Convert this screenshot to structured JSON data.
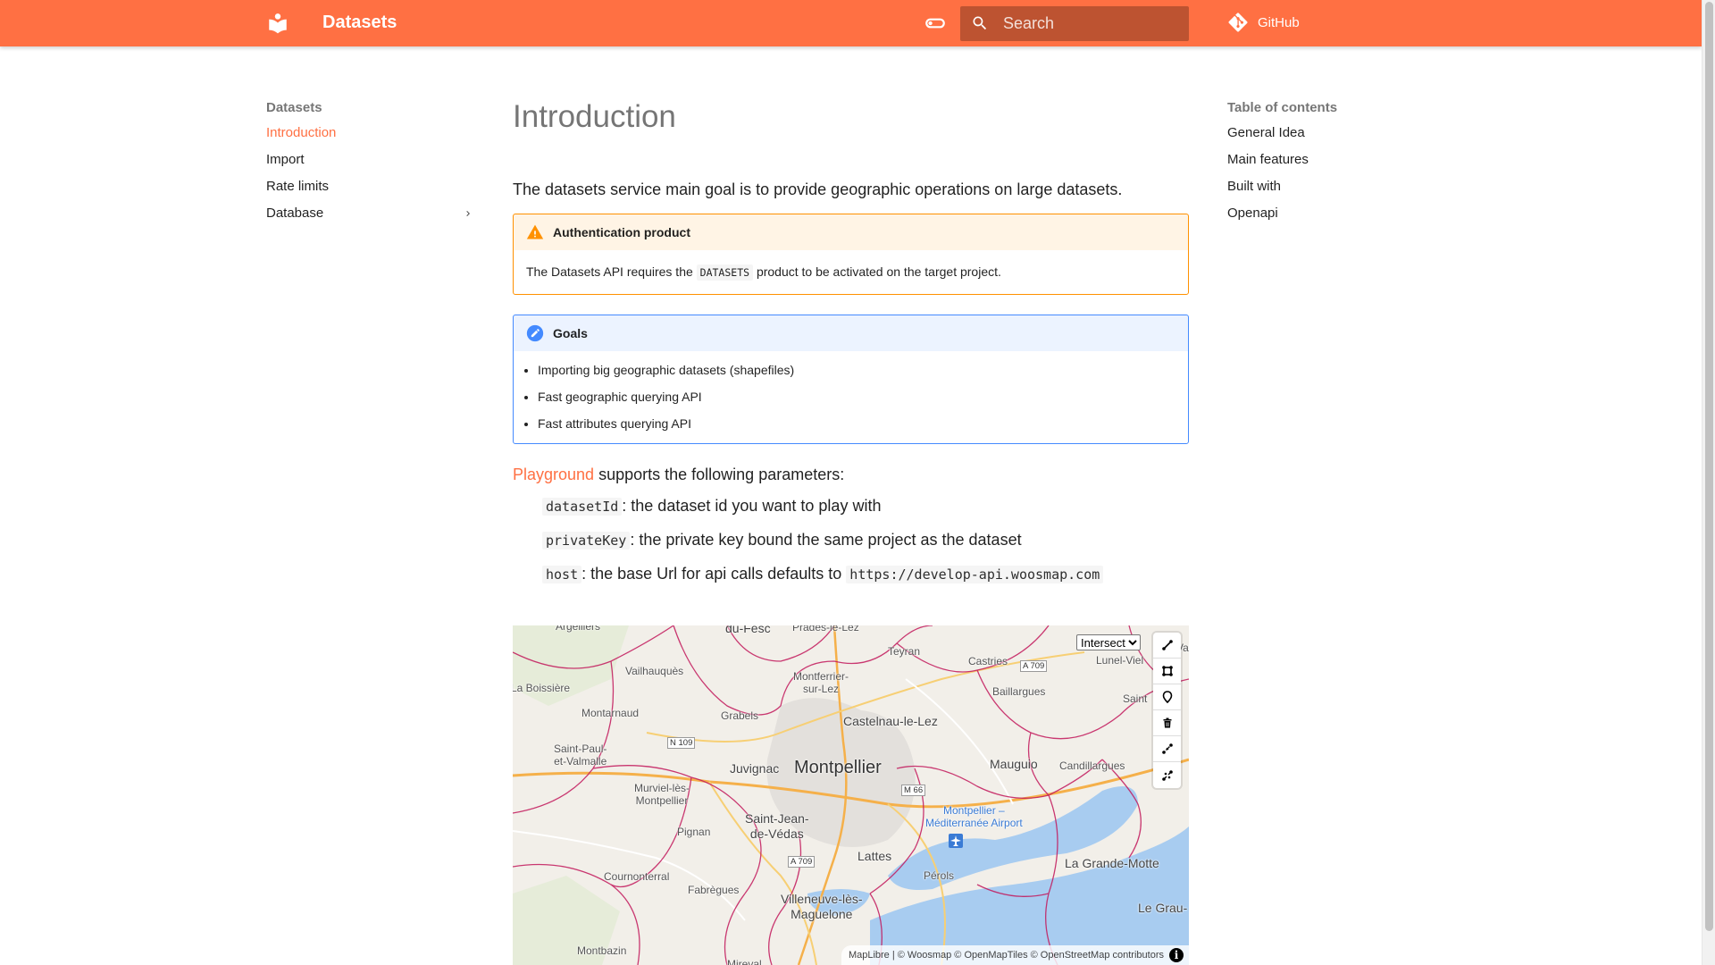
{
  "header": {
    "site_title": "Datasets",
    "search_placeholder": "Search",
    "repo_label": "GitHub"
  },
  "nav": {
    "title": "Datasets",
    "items": [
      {
        "label": "Introduction",
        "active": true
      },
      {
        "label": "Import"
      },
      {
        "label": "Rate limits"
      },
      {
        "label": "Database",
        "expandable": true
      }
    ]
  },
  "toc": {
    "title": "Table of contents",
    "items": [
      "General Idea",
      "Main features",
      "Built with",
      "Openapi"
    ]
  },
  "content": {
    "title": "Introduction",
    "intro": "The datasets service main goal is to provide geographic operations on large datasets.",
    "warning": {
      "title": "Authentication product",
      "text_before": "The Datasets API requires the",
      "code": "DATASETS",
      "text_after": "product to be activated on the target project."
    },
    "goals": {
      "title": "Goals",
      "items": [
        "Importing big geographic datasets (shapefiles)",
        "Fast geographic querying API",
        "Fast attributes querying API"
      ]
    },
    "params_link": "Playground",
    "params_text": "supports the following parameters:",
    "params": [
      {
        "code": "datasetId",
        "text": ": the dataset id you want to play with"
      },
      {
        "code": "privateKey",
        "text": ": the private key bound the same project as the dataset"
      },
      {
        "code": "host",
        "text": ": the base Url for api calls defaults to",
        "code2": "https://develop-api.woosmap.com"
      }
    ]
  },
  "map": {
    "select_value": "Intersect",
    "labels": {
      "argelliers": "Argelliers",
      "du_fesc": "du-Fesc",
      "prades": "Prades-le-Lez",
      "teyran": "Teyran",
      "castries": "Castries",
      "lunel_viel": "Lunel-Viel",
      "valflaunes": "Valflaunès",
      "la_boissiere": "La Boissière",
      "vailhauques": "Vailhauquès",
      "montferrier": "Montferrier-\nsur-Lez",
      "baillargues": "Baillargues",
      "saint_bres": "Saint",
      "montarnaud": "Montarnaud",
      "grabels": "Grabels",
      "castelnau": "Castelnau-le-Lez",
      "saint_paul": "Saint-Paul-\net-Valmalle",
      "juvignac": "Juvignac",
      "montpellier": "Montpellier",
      "mauguio": "Mauguio",
      "candillargues": "Candillargues",
      "murviel": "Murviel-lès-\nMontpellier",
      "saint_jean": "Saint-Jean-\nde-Védas",
      "pignan": "Pignan",
      "airport": "Montpellier –\nMéditerranée Airport",
      "lattes": "Lattes",
      "perols": "Pérols",
      "grande_motte": "La Grande-Motte",
      "cournonterral": "Cournonterral",
      "fabregues": "Fabrègues",
      "villeneuve": "Villeneuve-lès-\nMaguelone",
      "le_grau": "Le Grau-",
      "montbazin": "Montbazin",
      "mireval": "Mireval"
    },
    "roads": {
      "a709_n": "A 709",
      "n109": "N 109",
      "m66": "M 66",
      "a709_s": "A 709"
    },
    "attribution": "MapLibre | © Woosmap © OpenMapTiles © OpenStreetMap contributors",
    "attribution_info": "i"
  },
  "colors": {
    "primary": "#ff7043",
    "warning": "#ff9100",
    "note": "#448aff",
    "water": "#a8ccf0",
    "boundary": "#c2185b"
  }
}
